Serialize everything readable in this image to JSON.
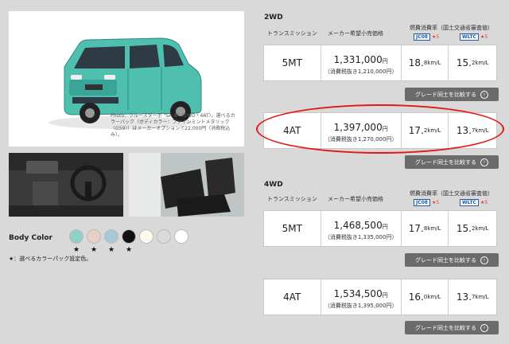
{
  "car_caption": "Photo：クルーズターボ \"SA Ⅲ\"（2WD・4AT）。選べるカラーパック（ボディカラー：ファインミントメタリック〈G59〉）はメーカーオプションで22,000円（消費税込み）。",
  "body_color": {
    "label": "Body Color",
    "swatches": [
      {
        "color": "#8ecfc7",
        "star": "★"
      },
      {
        "color": "#e8cfc9",
        "star": "★"
      },
      {
        "color": "#a9c8d8",
        "star": "★"
      },
      {
        "color": "#111111",
        "star": "★"
      },
      {
        "color": "#fbf8ec",
        "star": ""
      },
      {
        "color": "#d9dadc",
        "star": ""
      },
      {
        "color": "#ffffff",
        "star": ""
      }
    ],
    "footnote": "★：選べるカラーパック設定色。"
  },
  "headers": {
    "transmission": "トランスミッション",
    "price": "メーカー希望小売価格",
    "fuel": "燃費消費率（国土交通省審査値）",
    "mode1": "JC08",
    "mode2": "WLTC",
    "mode_stars": "★5"
  },
  "sections": [
    {
      "label": "2WD",
      "rows": [
        {
          "trans": "5MT",
          "price": "1,331,000",
          "price_unit": "円",
          "price_sub": "（消費税抜き1,210,000円）",
          "jc_int": "18.",
          "jc_dec": "8",
          "wltc_int": "15.",
          "wltc_dec": "2",
          "unit": " km/L",
          "button": "グレード同士を比較する"
        },
        {
          "trans": "4AT",
          "price": "1,397,000",
          "price_unit": "円",
          "price_sub": "（消費税抜き1,270,000円）",
          "jc_int": "17.",
          "jc_dec": "2",
          "wltc_int": "13.",
          "wltc_dec": "7",
          "unit": " km/L",
          "button": "グレード同士を比較する"
        }
      ]
    },
    {
      "label": "4WD",
      "rows": [
        {
          "trans": "5MT",
          "price": "1,468,500",
          "price_unit": "円",
          "price_sub": "（消費税抜き1,335,000円）",
          "jc_int": "17.",
          "jc_dec": "8",
          "wltc_int": "15.",
          "wltc_dec": "2",
          "unit": " km/L",
          "button": "グレード同士を比較する"
        },
        {
          "trans": "4AT",
          "price": "1,534,500",
          "price_unit": "円",
          "price_sub": "（消費税抜き1,395,000円）",
          "jc_int": "16.",
          "jc_dec": "0",
          "wltc_int": "13.",
          "wltc_dec": "7",
          "unit": " km/L",
          "button": "グレード同士を比較する"
        }
      ]
    }
  ],
  "colors": {
    "accent_red": "#e01818",
    "button_gray": "#6b6b6b",
    "car_body": "#4fc0b0"
  }
}
